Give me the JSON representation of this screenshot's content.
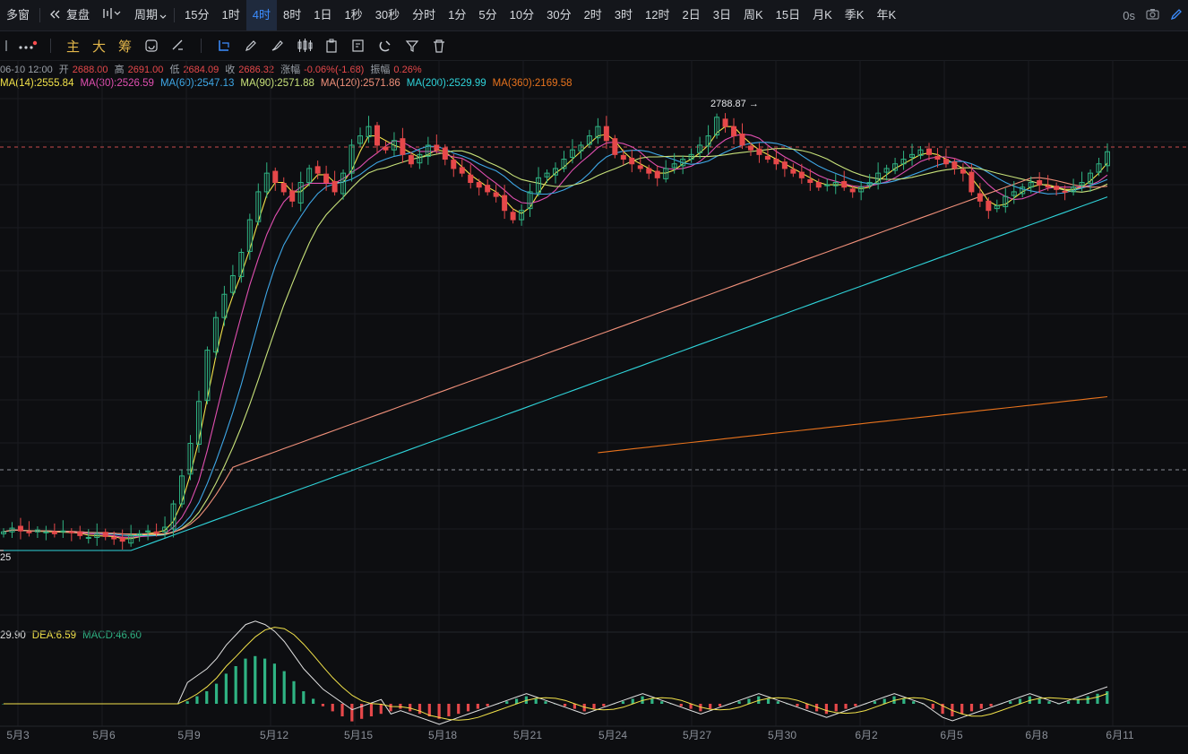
{
  "toolbar": {
    "items": [
      {
        "label": "多窗",
        "active": false
      },
      {
        "label": "复盘",
        "active": false
      },
      {
        "label": "周期",
        "active": false
      },
      {
        "label": "15分",
        "active": false
      },
      {
        "label": "1时",
        "active": false
      },
      {
        "label": "4时",
        "active": true
      },
      {
        "label": "8时",
        "active": false
      },
      {
        "label": "1日",
        "active": false
      },
      {
        "label": "1秒",
        "active": false
      },
      {
        "label": "30秒",
        "active": false
      },
      {
        "label": "分时",
        "active": false
      },
      {
        "label": "1分",
        "active": false
      },
      {
        "label": "5分",
        "active": false
      },
      {
        "label": "10分",
        "active": false
      },
      {
        "label": "30分",
        "active": false
      },
      {
        "label": "2时",
        "active": false
      },
      {
        "label": "3时",
        "active": false
      },
      {
        "label": "12时",
        "active": false
      },
      {
        "label": "2日",
        "active": false
      },
      {
        "label": "3日",
        "active": false
      },
      {
        "label": "周K",
        "active": false
      },
      {
        "label": "15日",
        "active": false
      },
      {
        "label": "月K",
        "active": false
      },
      {
        "label": "季K",
        "active": false
      },
      {
        "label": "年K",
        "active": false
      }
    ],
    "latency": "0s",
    "accent": "#3c8dff"
  },
  "indicators": {
    "main": "主",
    "big": "大",
    "chips": "筹"
  },
  "info": {
    "datetime": "06-10 12:00",
    "open_label": "开",
    "open": "2688.00",
    "high_label": "高",
    "high": "2691.00",
    "low_label": "低",
    "low": "2684.09",
    "close_label": "收",
    "close": "2686.32",
    "change_label": "涨幅",
    "change": "-0.06%(-1.68)",
    "amp_label": "振幅",
    "amp": "0.26%"
  },
  "ma": [
    {
      "label": "MA(14):2555.84",
      "color": "#f2e24a"
    },
    {
      "label": "MA(30):2526.59",
      "color": "#e04fb0"
    },
    {
      "label": "MA(60):2547.13",
      "color": "#3ea7e6"
    },
    {
      "label": "MA(90):2571.88",
      "color": "#c8e27a"
    },
    {
      "label": "MA(120):2571.86",
      "color": "#f0907a"
    },
    {
      "label": "MA(200):2529.99",
      "color": "#2fd3d9"
    },
    {
      "label": "MA(360):2169.58",
      "color": "#e8731d"
    }
  ],
  "macd": {
    "dif": "29.90",
    "dea": "DEA:6.59",
    "macd": "MACD:46.60"
  },
  "chart_data": {
    "type": "candlestick",
    "high_marker": "2788.87",
    "low_marker": "25",
    "x_tick_labels": [
      "5月3",
      "5月6",
      "5月9",
      "5月12",
      "5月15",
      "5月18",
      "5月21",
      "5月24",
      "5月27",
      "5月30",
      "6月2",
      "6月5",
      "6月8",
      "6月11"
    ],
    "approx_close": [
      1870,
      1878,
      1872,
      1868,
      1874,
      1870,
      1866,
      1872,
      1868,
      1862,
      1858,
      1865,
      1860,
      1855,
      1850,
      1862,
      1866,
      1872,
      1868,
      1880,
      1930,
      1990,
      2060,
      2150,
      2260,
      2330,
      2380,
      2420,
      2470,
      2540,
      2600,
      2640,
      2620,
      2600,
      2580,
      2620,
      2650,
      2640,
      2620,
      2600,
      2640,
      2700,
      2720,
      2740,
      2700,
      2690,
      2710,
      2680,
      2660,
      2680,
      2700,
      2690,
      2670,
      2650,
      2640,
      2620,
      2610,
      2600,
      2590,
      2560,
      2540,
      2560,
      2600,
      2630,
      2640,
      2650,
      2670,
      2690,
      2700,
      2720,
      2740,
      2710,
      2680,
      2670,
      2660,
      2650,
      2640,
      2630,
      2650,
      2660,
      2670,
      2680,
      2700,
      2720,
      2760,
      2740,
      2720,
      2700,
      2690,
      2680,
      2670,
      2660,
      2650,
      2640,
      2630,
      2620,
      2610,
      2615,
      2620,
      2610,
      2600,
      2610,
      2620,
      2640,
      2650,
      2660,
      2670,
      2680,
      2690,
      2680,
      2670,
      2660,
      2650,
      2640,
      2600,
      2580,
      2560,
      2570,
      2590,
      2600,
      2610,
      2620,
      2615,
      2610,
      2605,
      2600,
      2610,
      2620,
      2640,
      2660,
      2686
    ],
    "macd_hist_sample": [
      0,
      0,
      0,
      0,
      0,
      0,
      0,
      0,
      0,
      0,
      0,
      0,
      0,
      0,
      0,
      0,
      0,
      0,
      0,
      2,
      6,
      10,
      16,
      24,
      30,
      36,
      38,
      36,
      32,
      26,
      18,
      10,
      4,
      -2,
      -6,
      -10,
      -14,
      -12,
      -10,
      -8,
      -6,
      -4,
      -6,
      -8,
      -10,
      -12,
      -10,
      -8,
      -6,
      -4,
      -2,
      0,
      2,
      4,
      6,
      4,
      2,
      0,
      -2,
      -4,
      -6,
      -4,
      -2,
      0,
      2,
      4,
      6,
      4,
      2,
      0,
      -2,
      -4,
      -6,
      -4,
      -2,
      0,
      2,
      4,
      6,
      4,
      2,
      0,
      -2,
      -4,
      -6,
      -8,
      -6,
      -4,
      -2,
      0,
      2,
      4,
      6,
      4,
      2,
      0,
      -4,
      -8,
      -10,
      -8,
      -6,
      -4,
      -2,
      0,
      2,
      4,
      6,
      4,
      2,
      0,
      2,
      4,
      6,
      8,
      10
    ]
  }
}
